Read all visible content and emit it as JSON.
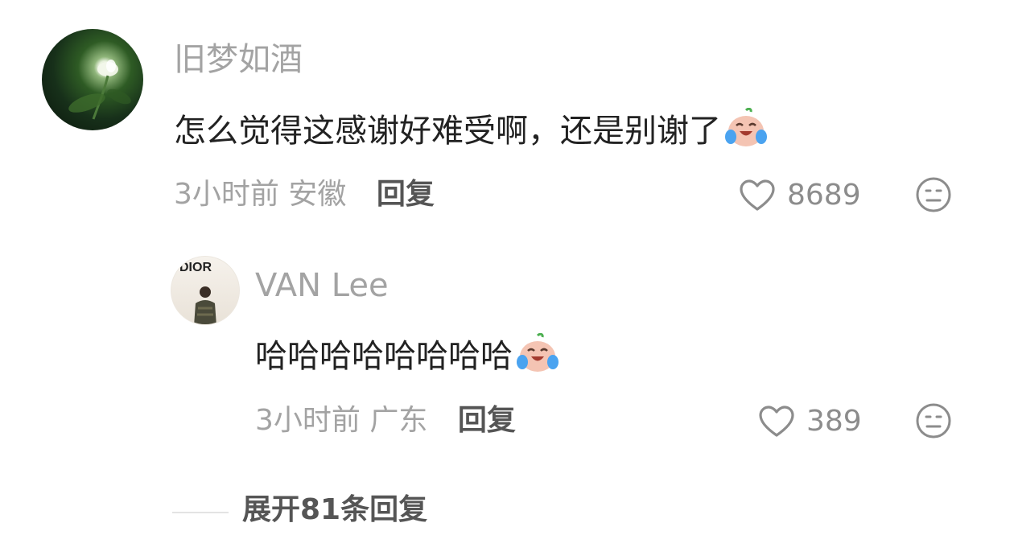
{
  "comment": {
    "username": "旧梦如酒",
    "text": "怎么觉得这感谢好难受啊，还是别谢了",
    "emoji": "laughing-tears-emoji",
    "time": "3小时前",
    "location": "安徽",
    "reply_label": "回复",
    "like_count": "8689"
  },
  "reply": {
    "username": "VAN Lee",
    "avatar_text": "DIOR",
    "text": "哈哈哈哈哈哈哈哈",
    "emoji": "laughing-tears-emoji",
    "time": "3小时前",
    "location": "广东",
    "reply_label": "回复",
    "like_count": "389"
  },
  "expand": {
    "label": "展开81条回复"
  },
  "colors": {
    "username": "#a3a3a3",
    "text": "#222222",
    "meta": "#a3a3a3",
    "action": "#555555"
  }
}
